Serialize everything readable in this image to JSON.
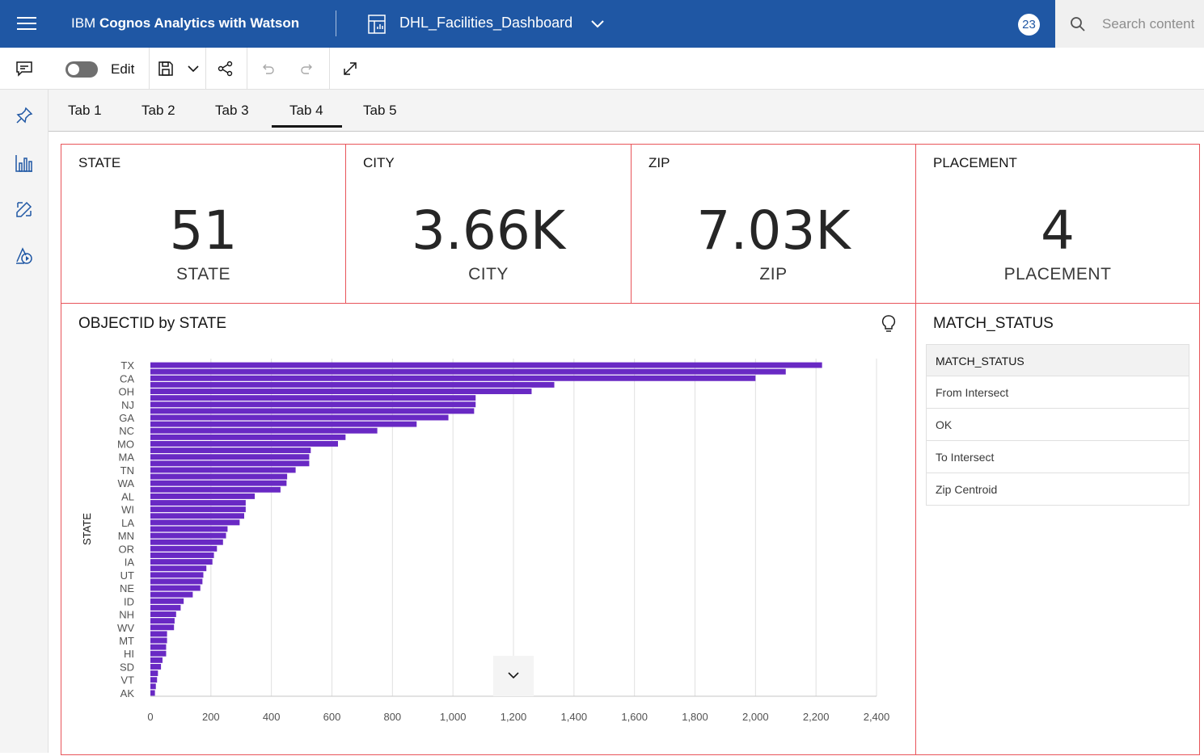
{
  "app": {
    "title_prefix": "IBM ",
    "title_bold": "Cognos Analytics with Watson",
    "dashboard_name": "DHL_Facilities_Dashboard",
    "notification_count": "23",
    "search_placeholder": "Search content",
    "brand_color": "#1f57a4"
  },
  "toolbar": {
    "edit_label": "Edit",
    "icons": [
      "comment-icon",
      "toggle",
      "save-icon",
      "chevron-down-icon",
      "share-icon",
      "undo-icon",
      "redo-icon",
      "expand-icon"
    ]
  },
  "left_rail": {
    "icons": [
      "comment-icon",
      "pin-icon",
      "visualizations-icon",
      "assets-icon",
      "data-icon"
    ]
  },
  "tabs": [
    {
      "label": "Tab 1"
    },
    {
      "label": "Tab 2"
    },
    {
      "label": "Tab 3"
    },
    {
      "label": "Tab 4",
      "active": true
    },
    {
      "label": "Tab 5"
    }
  ],
  "kpis": [
    {
      "title": "STATE",
      "value": "51",
      "label": "STATE"
    },
    {
      "title": "CITY",
      "value": "3.66K",
      "label": "CITY"
    },
    {
      "title": "ZIP",
      "value": "7.03K",
      "label": "ZIP"
    },
    {
      "title": "PLACEMENT",
      "value": "4",
      "label": "PLACEMENT"
    }
  ],
  "bar_widget": {
    "title": "OBJECTID by STATE"
  },
  "chart_data": {
    "type": "bar",
    "orientation": "horizontal",
    "ylabel": "STATE",
    "xlim": [
      0,
      2400
    ],
    "x_ticks": [
      "0",
      "200",
      "400",
      "600",
      "800",
      "1,000",
      "1,200",
      "1,400",
      "1,600",
      "1,800",
      "2,000",
      "2,200",
      "2,400"
    ],
    "categories": [
      "TX",
      "",
      "CA",
      "",
      "OH",
      "",
      "NJ",
      "",
      "GA",
      "",
      "NC",
      "",
      "MO",
      "",
      "MA",
      "",
      "TN",
      "",
      "WA",
      "",
      "AL",
      "",
      "WI",
      "",
      "LA",
      "",
      "MN",
      "",
      "OR",
      "",
      "IA",
      "",
      "UT",
      "",
      "NE",
      "",
      "ID",
      "",
      "NH",
      "",
      "WV",
      "",
      "MT",
      "",
      "HI",
      "",
      "SD",
      "",
      "VT",
      "",
      "AK"
    ],
    "values": [
      2220,
      2100,
      2000,
      1335,
      1260,
      1075,
      1075,
      1070,
      985,
      880,
      750,
      645,
      620,
      530,
      525,
      525,
      480,
      452,
      450,
      430,
      345,
      315,
      315,
      310,
      295,
      255,
      250,
      240,
      220,
      210,
      205,
      185,
      175,
      172,
      165,
      140,
      110,
      100,
      85,
      80,
      78,
      55,
      55,
      52,
      52,
      40,
      35,
      25,
      22,
      18,
      15
    ],
    "bar_color": "#6929c4",
    "grid": true
  },
  "status_widget": {
    "title": "MATCH_STATUS",
    "column_header": "MATCH_STATUS",
    "rows": [
      "From Intersect",
      "OK",
      "To Intersect",
      "Zip Centroid"
    ]
  },
  "colors": {
    "card_border": "#e8545a",
    "rail_bg": "#f4f4f4"
  }
}
